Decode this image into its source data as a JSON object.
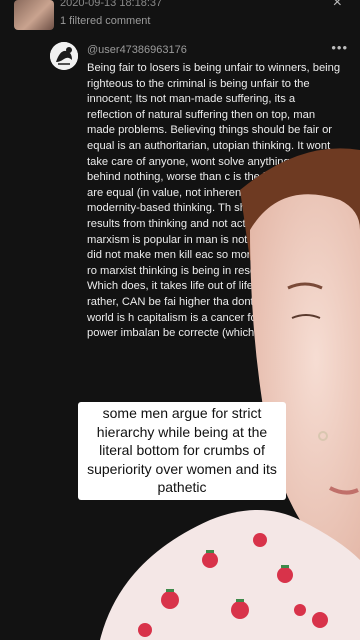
{
  "header": {
    "date_partial": "2020-09-13 18:18:37",
    "filtered_label": "1 filtered comment",
    "close_glyph": "×"
  },
  "comment": {
    "username": "@user47386963176",
    "more_glyph": "•••",
    "text": "Being fair to losers is being unfair to winners, being righteous to the criminal is being unfair to the innocent; Its not man-made suffering, its a reflection of natural suffering then on top, man made problems. Believing things should be fair or equal is an authoritarian, utopian thinking. It wont take care of anyone, wont solve anything, w leave behind nothing, worse than c is the belief all men are equal (in value, not inherent) . Its sterili modernity-based thinking. Th should be \"fair\" results from thinking and not actually th (why marxism is popular in man is not equal to himsel did not make men kill eac so more efficiently. The ro marxist thinking is being in resentful, pitiful life. Which does, it takes life out of life. should, or rather, CAN be fai higher tha dont ea had to kill, the world is h capitalism is a cancer for the love of God power imbalan be correcte (which it or out cont"
  },
  "caption": {
    "text": "some men argue for strict hierarchy while being at the literal bottom for crumbs of superiority over women and its pathetic"
  },
  "colors": {
    "background": "#121212",
    "caption_bg": "#ffffff",
    "skin": "#f1d3c8",
    "hair": "#7a3f24",
    "shirt": "#f4e7e6",
    "strawberry": "#d8334a"
  }
}
